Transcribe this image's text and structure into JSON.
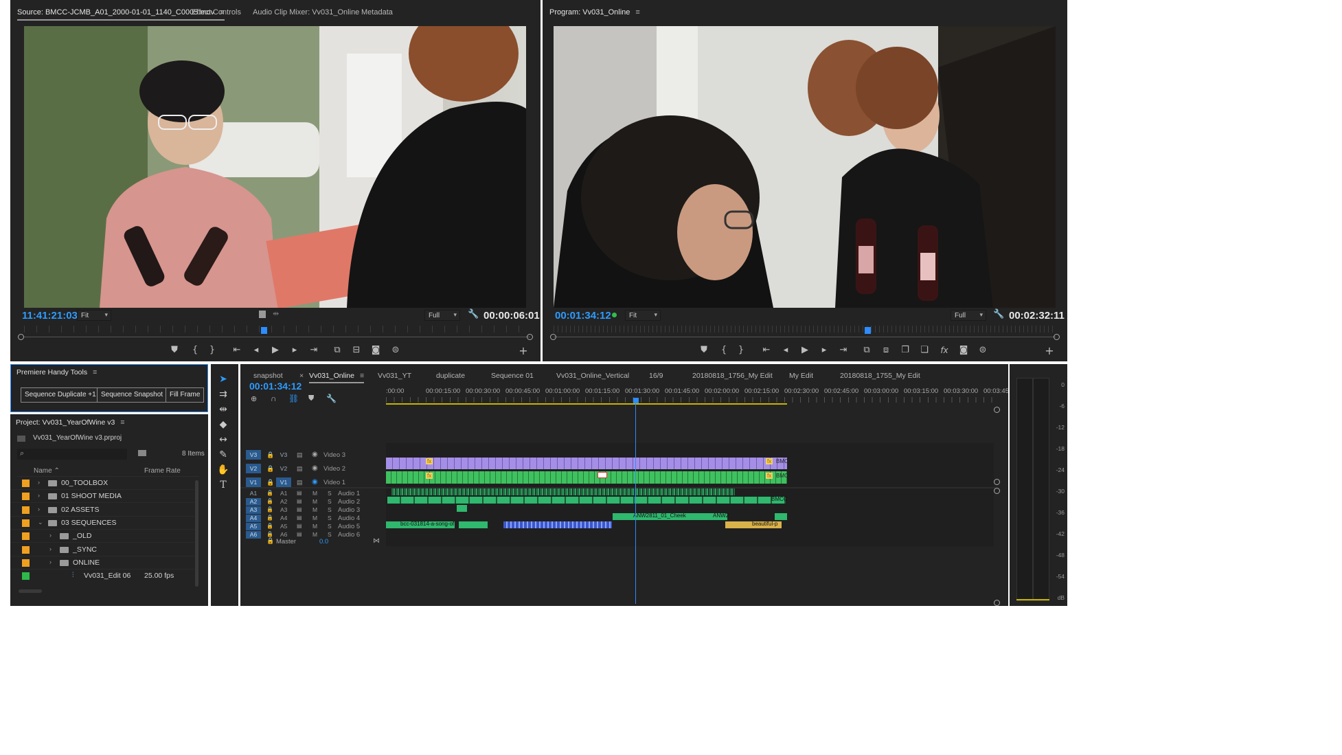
{
  "source_monitor": {
    "tabs": [
      "Source: BMCC-JCMB_A01_2000-01-01_1140_C0005.mov",
      "Effect Controls",
      "Audio Clip Mixer: Vv031_Online",
      "Metadata"
    ],
    "menu_icon": "≡",
    "timecode_in": "11:41:21:03",
    "zoom": "Fit",
    "resolution": "Full",
    "duration": "00:00:06:01",
    "playhead_fraction": 0.47
  },
  "program_monitor": {
    "title": "Program: Vv031_Online",
    "menu_icon": "≡",
    "timecode": "00:01:34:12",
    "zoom": "Fit",
    "resolution": "Full",
    "duration": "00:02:32:11",
    "playhead_fraction": 0.62
  },
  "handy_tools": {
    "title": "Premiere Handy Tools",
    "buttons": [
      "Sequence Duplicate +1",
      "Sequence Snapshot",
      "Fill Frame"
    ]
  },
  "project": {
    "title": "Project: Vv031_YearOfWine v3",
    "file": "Vv031_YearOfWine v3.prproj",
    "item_count": "8 Items",
    "columns": [
      "Name",
      "Frame Rate"
    ],
    "items": [
      {
        "name": "00_TOOLBOX",
        "color": "#f0a020",
        "indent": 0,
        "type": "bin",
        "frame_rate": ""
      },
      {
        "name": "01 SHOOT MEDIA",
        "color": "#f0a020",
        "indent": 0,
        "type": "bin",
        "frame_rate": ""
      },
      {
        "name": "02 ASSETS",
        "color": "#f0a020",
        "indent": 0,
        "type": "bin",
        "frame_rate": ""
      },
      {
        "name": "03 SEQUENCES",
        "color": "#f0a020",
        "indent": 0,
        "type": "bin-open",
        "frame_rate": ""
      },
      {
        "name": "_OLD",
        "color": "#f0a020",
        "indent": 1,
        "type": "bin",
        "frame_rate": ""
      },
      {
        "name": "_SYNC",
        "color": "#f0a020",
        "indent": 1,
        "type": "bin",
        "frame_rate": ""
      },
      {
        "name": "ONLINE",
        "color": "#f0a020",
        "indent": 1,
        "type": "bin",
        "frame_rate": ""
      },
      {
        "name": "Vv031_Edit 06",
        "color": "#2fb84a",
        "indent": 1,
        "type": "sequence",
        "frame_rate": "25.00 fps"
      }
    ]
  },
  "timeline": {
    "tabs": [
      "snapshot",
      "Vv031_Online",
      "Vv031_YT",
      "duplicate",
      "Sequence 01",
      "Vv031_Online_Vertical",
      "16/9",
      "20180818_1756_My Edit",
      "My Edit",
      "20180818_1755_My Edit"
    ],
    "active_tab": "Vv031_Online",
    "close_icon": "×",
    "menu_icon": "≡",
    "timecode": "00:01:34:12",
    "ruler": [
      ":00:00",
      "00:00:15:00",
      "00:00:30:00",
      "00:00:45:00",
      "00:01:00:00",
      "00:01:15:00",
      "00:01:30:00",
      "00:01:45:00",
      "00:02:00:00",
      "00:02:15:00",
      "00:02:30:00",
      "00:02:45:00",
      "00:03:00:00",
      "00:03:15:00",
      "00:03:30:00",
      "00:03:45:00"
    ],
    "video_tracks": [
      {
        "src": "V3",
        "id": "V3",
        "name": "Video 3"
      },
      {
        "src": "V2",
        "id": "V2",
        "name": "Video 2"
      },
      {
        "src": "V1",
        "id": "V1",
        "name": "Video 1"
      }
    ],
    "audio_tracks": [
      {
        "src": "A1",
        "id": "A1",
        "name": "Audio 1"
      },
      {
        "src": "A2",
        "id": "A2",
        "name": "Audio 2"
      },
      {
        "src": "A3",
        "id": "A3",
        "name": "Audio 3"
      },
      {
        "src": "A4",
        "id": "A4",
        "name": "Audio 4"
      },
      {
        "src": "A5",
        "id": "A5",
        "name": "Audio 5"
      },
      {
        "src": "A6",
        "id": "A6",
        "name": "Audio 6"
      }
    ],
    "mute_label": "M",
    "solo_label": "S",
    "master_label": "Master",
    "master_value": "0.0",
    "clip_labels": [
      "BMC",
      "BMC",
      "BMCC",
      "ANW2811_01_Cheek",
      "ANW2",
      "bcc-031814-a-song-of",
      "beautiful-p"
    ],
    "playhead_fraction": 0.41
  },
  "audio_meter": {
    "scale": [
      "0",
      "-6",
      "-12",
      "-18",
      "-24",
      "-30",
      "-36",
      "-42",
      "-48",
      "-54",
      "dB"
    ]
  },
  "colors": {
    "panel": "#232323",
    "accent": "#2d9cff",
    "video_clip": "#a08ce0",
    "video_clip_green": "#3cc060",
    "audio_clip": "#2fb86e"
  }
}
